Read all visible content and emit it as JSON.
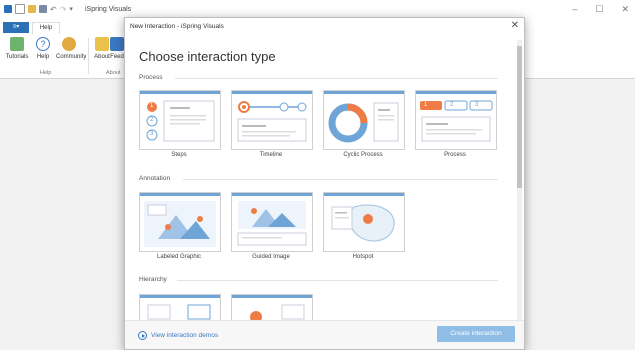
{
  "app": {
    "title": "iSpring Visuals",
    "window_controls": [
      "–",
      "☐",
      "✕"
    ],
    "file_tab": "≡▾",
    "help_tab": "Help"
  },
  "ribbon": {
    "buttons": [
      {
        "label": "Tutorials",
        "icon": "tutorials-icon"
      },
      {
        "label": "Help",
        "icon": "help-icon"
      },
      {
        "label": "Community",
        "icon": "community-icon"
      },
      {
        "label": "About",
        "icon": "about-icon"
      },
      {
        "label": "Feed",
        "icon": "feedback-icon"
      }
    ],
    "groups": [
      "Help",
      "About"
    ]
  },
  "dialog": {
    "title": "New Interaction - iSpring Visuals",
    "heading": "Choose interaction type",
    "sections": [
      {
        "label": "Process",
        "cards": [
          "Steps",
          "Timeline",
          "Cyclic Process",
          "Process"
        ]
      },
      {
        "label": "Annotation",
        "cards": [
          "Labeled Graphic",
          "Guided Image",
          "Hotspot"
        ]
      },
      {
        "label": "Hierarchy",
        "cards": [
          "",
          ""
        ]
      }
    ],
    "process_badges": [
      "1",
      "2",
      "3"
    ],
    "steps_numbers": [
      "1",
      "2",
      "3"
    ],
    "footer_link": "View interaction demos",
    "create_button": "Create interaction"
  },
  "colors": {
    "accent": "#f07c45",
    "blue": "#6fa4d6",
    "button": "#8fbde6",
    "link": "#3a78c3"
  }
}
